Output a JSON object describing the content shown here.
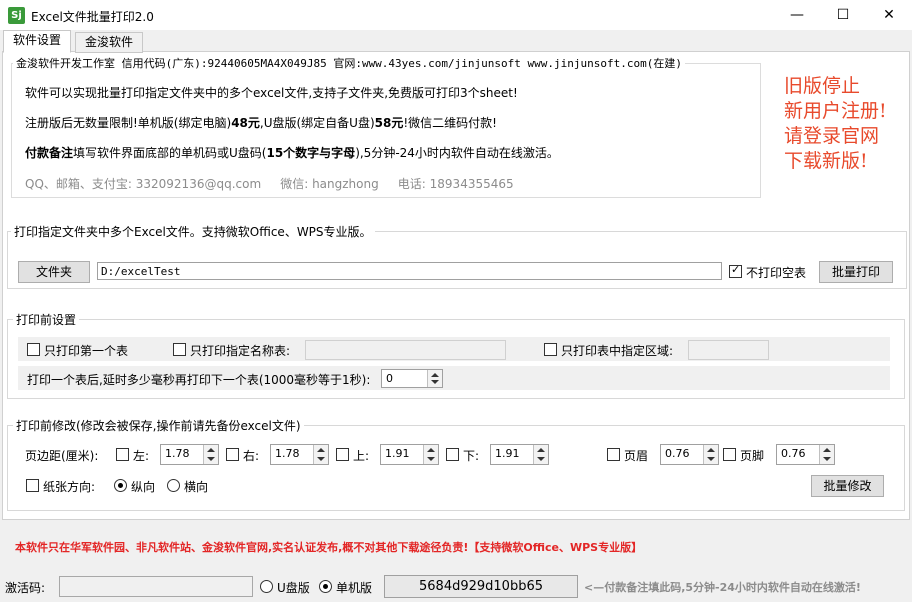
{
  "window": {
    "title": "Excel文件批量打印2.0",
    "icon_text": "Sj",
    "minimize": "—",
    "maximize": "☐",
    "close": "✕"
  },
  "tabs": [
    {
      "label": "软件设置"
    },
    {
      "label": "金浚软件"
    }
  ],
  "info": {
    "header": "金浚软件开发工作室 信用代码(广东):92440605MA4X049J85 官网:www.43yes.com/jinjunsoft  www.jinjunsoft.com(在建)",
    "line1": "软件可以实现批量打印指定文件夹中的多个excel文件,支持子文件夹,免费版可打印3个sheet!",
    "line2_a": "注册版后无数量限制!单机版(绑定电脑)",
    "line2_b": "48元",
    "line2_c": ",U盘版(绑定自备U盘)",
    "line2_d": "58元",
    "line2_e": "!微信二维码付款!",
    "line3_a": "付款备注",
    "line3_b": "填写软件界面底部的单机码或U盘码(",
    "line3_c": "15个数字与字母",
    "line3_d": "),5分钟-24小时内软件自动在线激活。",
    "contact": "QQ、邮箱、支付宝: 332092136@qq.com     微信: hangzhong     电话: 18934355465"
  },
  "notice": {
    "l1": "旧版停止",
    "l2": "新用户注册!",
    "l3": "请登录官网",
    "l4": "下载新版!"
  },
  "print_group": {
    "legend": "打印指定文件夹中多个Excel文件。支持微软Office、WPS专业版。",
    "folder_button": "文件夹",
    "folder_path": "D:/excelTest",
    "skip_blank_label": "不打印空表",
    "skip_blank_checked": true,
    "batch_print_button": "批量打印"
  },
  "pre_settings": {
    "legend": "打印前设置",
    "first_sheet_label": "只打印第一个表",
    "named_sheet_label": "只打印指定名称表:",
    "named_sheet_value": "",
    "area_label": "只打印表中指定区域:",
    "area_value": "",
    "delay_label": "打印一个表后,延时多少毫秒再打印下一个表(1000毫秒等于1秒):",
    "delay_value": "0"
  },
  "modify": {
    "legend": "打印前修改(修改会被保存,操作前请先备份excel文件)",
    "margin_label": "页边距(厘米):",
    "left_label": "左:",
    "left_value": "1.78",
    "right_label": "右:",
    "right_value": "1.78",
    "top_label": "上:",
    "top_value": "1.91",
    "bottom_label": "下:",
    "bottom_value": "1.91",
    "header_label": "页眉",
    "header_value": "0.76",
    "footer_label": "页脚",
    "footer_value": "0.76",
    "orientation_label": "纸张方向:",
    "portrait_label": "纵向",
    "landscape_label": "横向",
    "orientation_selected": "portrait",
    "batch_modify_button": "批量修改"
  },
  "disclaimer": "本软件只在华军软件园、非凡软件站、金浚软件官网,实名认证发布,概不对其他下载途径负责!【支持微软Office、WPS专业版】",
  "status": {
    "activation_label": "激活码:",
    "activation_value": "",
    "usb_label": "U盘版",
    "standalone_label": "单机版",
    "version_selected": "standalone",
    "machine_code": "5684d929d10bb65",
    "hint": "<—付款备注填此码,5分钟-24小时内软件自动在线激活!"
  },
  "colors": {
    "accent_red": "#e32626",
    "notice_red": "#e84a2c"
  }
}
